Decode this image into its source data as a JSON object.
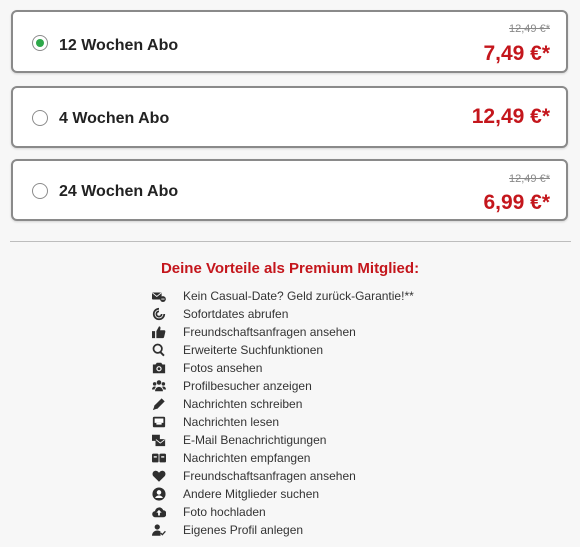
{
  "plans": [
    {
      "name": "12 Wochen Abo",
      "old_price": "12,49 €*",
      "price": "7,49 €*",
      "selected": true
    },
    {
      "name": "4 Wochen Abo",
      "old_price": "",
      "price": "12,49 €*",
      "selected": false
    },
    {
      "name": "24 Wochen Abo",
      "old_price": "12,49 €*",
      "price": "6,99 €*",
      "selected": false
    }
  ],
  "benefits": {
    "title": "Deine Vorteile als Premium Mitglied:",
    "items": [
      {
        "label": "Kein Casual-Date? Geld zurück-Garantie!**",
        "icon": "no-entry-envelope-icon"
      },
      {
        "label": "Sofortdates abrufen",
        "icon": "spiral-icon"
      },
      {
        "label": "Freundschaftsanfragen ansehen",
        "icon": "thumbs-up-icon"
      },
      {
        "label": "Erweiterte Suchfunktionen",
        "icon": "search-icon"
      },
      {
        "label": "Fotos ansehen",
        "icon": "camera-icon"
      },
      {
        "label": "Profilbesucher anzeigen",
        "icon": "users-icon"
      },
      {
        "label": "Nachrichten schreiben",
        "icon": "pencil-icon"
      },
      {
        "label": "Nachrichten lesen",
        "icon": "inbox-icon"
      },
      {
        "label": "E-Mail Benachrichtigungen",
        "icon": "mail-notification-icon"
      },
      {
        "label": "Nachrichten empfangen",
        "icon": "chat-icon"
      },
      {
        "label": "Freundschaftsanfragen ansehen",
        "icon": "heart-icon"
      },
      {
        "label": "Andere Mitglieder suchen",
        "icon": "user-circle-icon"
      },
      {
        "label": "Foto hochladen",
        "icon": "cloud-upload-icon"
      },
      {
        "label": "Eigenes Profil anlegen",
        "icon": "user-check-icon"
      }
    ]
  },
  "colors": {
    "accent": "#c4161c",
    "radio_selected": "#2ea84a"
  }
}
